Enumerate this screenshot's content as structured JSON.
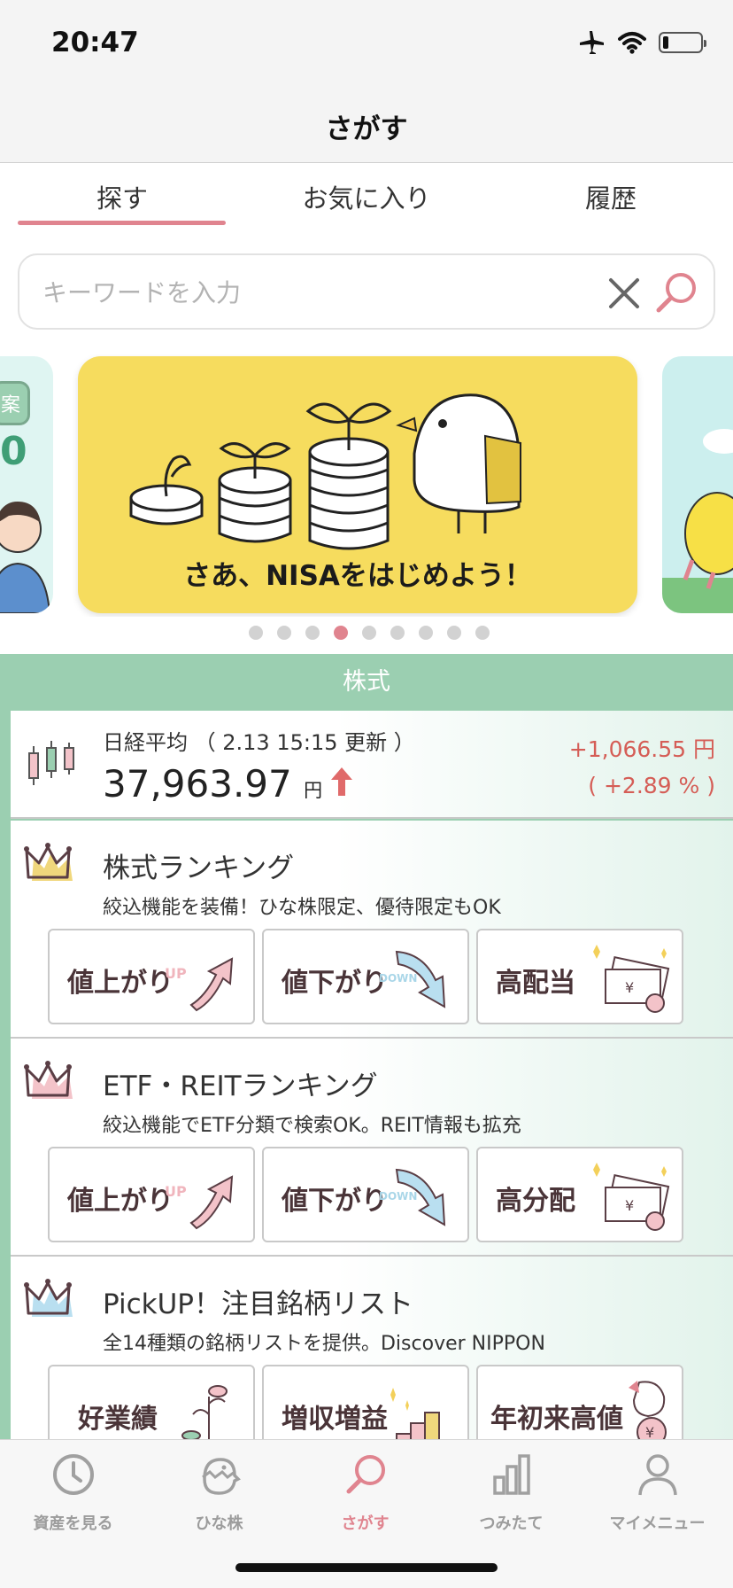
{
  "status_bar": {
    "time": "20:47",
    "battery_level": 0.15
  },
  "nav": {
    "title": "さがす"
  },
  "tabs": [
    {
      "label": "探す",
      "active": true
    },
    {
      "label": "お気に入り",
      "active": false
    },
    {
      "label": "履歴",
      "active": false
    }
  ],
  "search": {
    "placeholder": "キーワードを入力",
    "value": ""
  },
  "carousel": {
    "left_card": {
      "tag": "案",
      "digit": "0"
    },
    "banner_text": "さあ、NISAをはじめよう！",
    "page_count": 9,
    "active_page": 4
  },
  "stocks": {
    "section_label": "株式",
    "nikkei": {
      "title": "日経平均 （ 2.13 15:15 更新 ）",
      "value": "37,963.97",
      "unit": "円",
      "change": "+1,066.55 円",
      "change_pct": "( +2.89 % )"
    },
    "rankings": [
      {
        "title": "株式ランキング",
        "subtitle": "絞込機能を装備！ひな株限定、優待限定もOK",
        "crown_color": "#f0d77c",
        "buttons": [
          {
            "label": "値上がり",
            "icon": "up-arrow-icon",
            "tag": "UP"
          },
          {
            "label": "値下がり",
            "icon": "down-arrow-icon",
            "tag": "DOWN"
          },
          {
            "label": "高配当",
            "icon": "money-icon",
            "tag": "¥"
          }
        ]
      },
      {
        "title": "ETF・REITランキング",
        "subtitle": "絞込機能でETF分類で検索OK。REIT情報も拡充",
        "crown_color": "#f3c3c9",
        "buttons": [
          {
            "label": "値上がり",
            "icon": "up-arrow-icon",
            "tag": "UP"
          },
          {
            "label": "値下がり",
            "icon": "down-arrow-icon",
            "tag": "DOWN"
          },
          {
            "label": "高分配",
            "icon": "money-icon",
            "tag": "¥"
          }
        ]
      },
      {
        "title": "PickUP！注目銘柄リスト",
        "subtitle": "全14種類の銘柄リストを提供。Discover NIPPON",
        "crown_color": "#b9dff0",
        "buttons": [
          {
            "label": "好業績",
            "icon": "sprout-icon"
          },
          {
            "label": "増収増益",
            "icon": "bar-growth-icon"
          },
          {
            "label": "年初来高値",
            "icon": "bird-coin-icon",
            "tag": "¥"
          }
        ]
      }
    ]
  },
  "tab_bar": [
    {
      "label": "資産を見る",
      "icon": "clock-icon",
      "active": false
    },
    {
      "label": "ひな株",
      "icon": "chick-icon",
      "active": false
    },
    {
      "label": "さがす",
      "icon": "search-icon",
      "active": true
    },
    {
      "label": "つみたて",
      "icon": "bar-chart-icon",
      "active": false
    },
    {
      "label": "マイメニュー",
      "icon": "person-icon",
      "active": false
    }
  ],
  "colors": {
    "accent_pink": "#e0848f",
    "section_green": "#9bcfb1",
    "price_red": "#d55d56",
    "banner_yellow": "#f6dc5e"
  }
}
